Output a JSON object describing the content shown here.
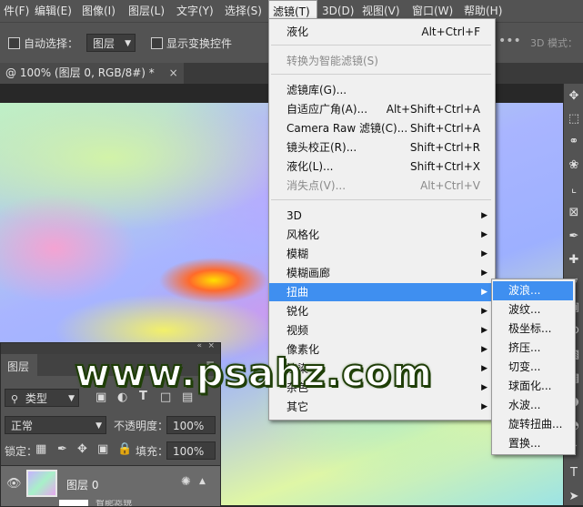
{
  "menubar": {
    "items": [
      {
        "label": "件(F)"
      },
      {
        "label": "编辑(E)"
      },
      {
        "label": "图像(I)"
      },
      {
        "label": "图层(L)"
      },
      {
        "label": "文字(Y)"
      },
      {
        "label": "选择(S)"
      },
      {
        "label": "滤镜(T)"
      },
      {
        "label": "3D(D)"
      },
      {
        "label": "视图(V)"
      },
      {
        "label": "窗口(W)"
      },
      {
        "label": "帮助(H)"
      }
    ]
  },
  "options": {
    "auto_select_label": "自动选择：",
    "layer_combo_value": "图层",
    "show_transform_label": "显示变换控件",
    "mode_3d_label": "3D 模式："
  },
  "document": {
    "tab_title": "@ 100% (图层 0, RGB/8#) *"
  },
  "filter_menu": {
    "items": [
      {
        "label": "液化",
        "shortcut": "Alt+Ctrl+F"
      },
      {
        "label": "转换为智能滤镜(S)",
        "shortcut": ""
      },
      {
        "label": "滤镜库(G)...",
        "shortcut": ""
      },
      {
        "label": "自适应广角(A)...",
        "shortcut": "Alt+Shift+Ctrl+A"
      },
      {
        "label": "Camera Raw 滤镜(C)...",
        "shortcut": "Shift+Ctrl+A"
      },
      {
        "label": "镜头校正(R)...",
        "shortcut": "Shift+Ctrl+R"
      },
      {
        "label": "液化(L)...",
        "shortcut": "Shift+Ctrl+X"
      },
      {
        "label": "消失点(V)...",
        "shortcut": "Alt+Ctrl+V"
      },
      {
        "label": "3D"
      },
      {
        "label": "风格化"
      },
      {
        "label": "模糊"
      },
      {
        "label": "模糊画廊"
      },
      {
        "label": "扭曲"
      },
      {
        "label": "锐化"
      },
      {
        "label": "视频"
      },
      {
        "label": "像素化"
      },
      {
        "label": "渲染"
      },
      {
        "label": "杂色"
      },
      {
        "label": "其它"
      }
    ]
  },
  "distort_submenu": {
    "items": [
      {
        "label": "波浪..."
      },
      {
        "label": "波纹..."
      },
      {
        "label": "极坐标..."
      },
      {
        "label": "挤压..."
      },
      {
        "label": "切变..."
      },
      {
        "label": "球面化..."
      },
      {
        "label": "水波..."
      },
      {
        "label": "旋转扭曲..."
      },
      {
        "label": "置换..."
      }
    ]
  },
  "layers_panel": {
    "title": "图层",
    "filter_kind": "类型",
    "blend_mode": "正常",
    "opacity_label": "不透明度：",
    "opacity_value": "100%",
    "lock_label": "锁定：",
    "fill_label": "填充：",
    "fill_value": "100%",
    "layer_name": "图层 0",
    "sublayer_name": "智能滤镜"
  },
  "watermark": {
    "text": "www.psahz.com"
  },
  "colors": {
    "menu_highlight": "#3f8ff0",
    "panel_bg": "#535353",
    "menu_bg": "#f0f0f0"
  }
}
